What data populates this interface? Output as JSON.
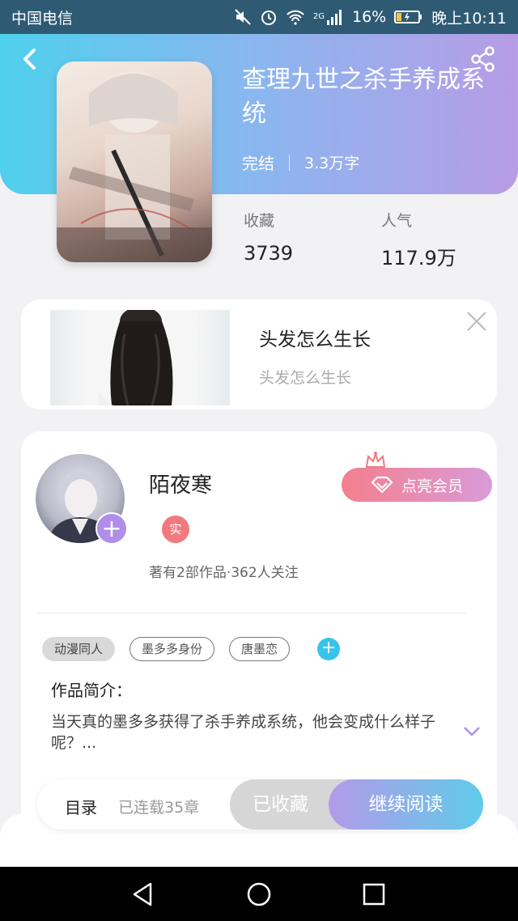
{
  "status_bar": {
    "carrier": "中国电信",
    "signal_label": "2G",
    "battery": "16%",
    "time": "晚上10:11"
  },
  "book": {
    "title": "查理九世之杀手养成系统",
    "status": "完结",
    "word_count": "3.3万字",
    "favorites_label": "收藏",
    "favorites_value": "3739",
    "popularity_label": "人气",
    "popularity_value": "117.9万"
  },
  "ad": {
    "title": "头发怎么生长",
    "subtitle": "头发怎么生长"
  },
  "author": {
    "name": "陌夜寒",
    "verified_badge": "实",
    "stats": "著有2部作品·362人关注",
    "vip_button": "点亮会员"
  },
  "tags": [
    "动漫同人",
    "墨多多身份",
    "唐墨恋"
  ],
  "intro": {
    "label": "作品简介：",
    "text": "当天真的墨多多获得了杀手养成系统，他会变成什么样子呢？..."
  },
  "action_bar": {
    "toc_label": "目录",
    "serial_status": "已连载35章",
    "collected_label": "已收藏",
    "continue_label": "继续阅读"
  },
  "colors": {
    "header_gradient_start": "#4fd0ec",
    "header_gradient_end": "#b79ce6",
    "accent_purple": "#b08ee8",
    "accent_cyan": "#38c4ea",
    "vip_pink": "#f47f8c"
  }
}
